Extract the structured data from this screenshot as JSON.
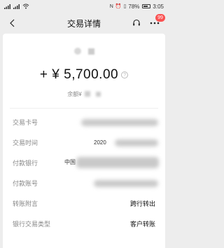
{
  "status_bar": {
    "battery_percent": "78%",
    "time": "3:05"
  },
  "nav": {
    "title": "交易详情",
    "badge_count": "99"
  },
  "amount": "+ ¥ 5,700.00",
  "balance_label": "余额¥",
  "details": [
    {
      "label": "交易卡号",
      "value": ""
    },
    {
      "label": "交易时间",
      "value": "2020"
    },
    {
      "label": "付款银行",
      "value": "中国"
    },
    {
      "label": "付款账号",
      "value": ""
    },
    {
      "label": "转账附言",
      "value": "跨行转出"
    },
    {
      "label": "银行交易类型",
      "value": "客户转账"
    }
  ],
  "colors": {
    "badge": "#fa5151",
    "background": "#ededed",
    "card": "#ffffff"
  }
}
